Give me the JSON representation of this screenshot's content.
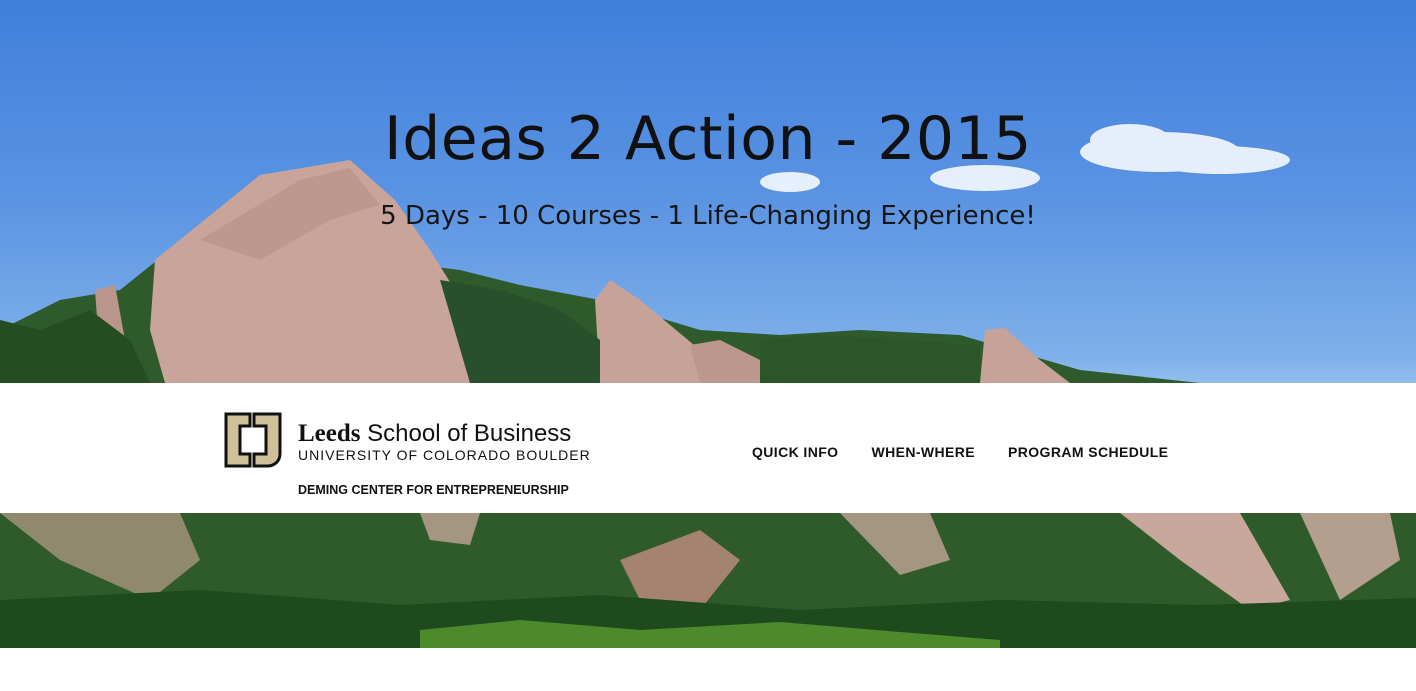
{
  "hero": {
    "title": "Ideas 2 Action - 2015",
    "subtitle": "5 Days - 10 Courses - 1 Life-Changing Experience!"
  },
  "header": {
    "logo": {
      "wordmark_bold": "Leeds",
      "wordmark_rest": " School of Business",
      "university": "UNIVERSITY OF COLORADO BOULDER",
      "center": "DEMING CENTER FOR ENTREPRENEURSHIP"
    },
    "nav": [
      {
        "label": "QUICK INFO"
      },
      {
        "label": "WHEN-WHERE"
      },
      {
        "label": "PROGRAM SCHEDULE"
      }
    ]
  },
  "colors": {
    "sky": "#5a93e2",
    "text": "#111111",
    "logo_gold": "#cfc09a",
    "band": "#ffffff"
  }
}
